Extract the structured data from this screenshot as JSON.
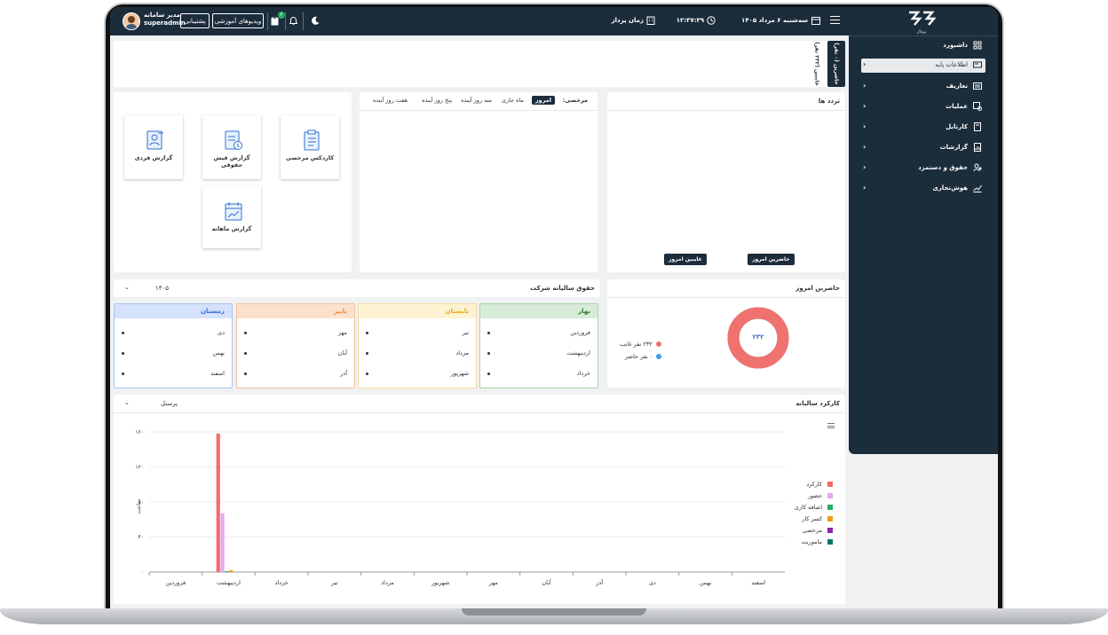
{
  "header": {
    "user_role": "مدیر سامانه",
    "username": "superadmin",
    "support_label": "پشتیبانی",
    "videos_label": "ویدیوهای آموزشی",
    "notif_count": "۴",
    "date": "سه‌شنبه ۶ مرداد ۱۴۰۵",
    "time": "۱۲:۳۷:۳۹",
    "timezone_label": "زمان پرداز"
  },
  "sidebar": {
    "logo_text": "پرداز",
    "items": [
      {
        "label": "داشبورد"
      },
      {
        "label": "اطلاعات پایه"
      },
      {
        "label": "تعاریف"
      },
      {
        "label": "عملیات"
      },
      {
        "label": "کارتابل"
      },
      {
        "label": "گزارشات"
      },
      {
        "label": "حقوق و دستمزد"
      },
      {
        "label": "هوش‌تجاری"
      }
    ]
  },
  "present_strip": {
    "tab_present": "حاضرین (۰ نفر)",
    "tab_absent": "غایبین (۲۳۲ نفر)"
  },
  "traffic": {
    "title": "تردد ها",
    "btn_present_today": "حاضرین امروز",
    "btn_absent_today": "غایبین امروز"
  },
  "leave": {
    "label": "مرخصی:",
    "tabs": [
      "امروز",
      "ماه جاری",
      "سه روز آینده",
      "پنج روز آینده",
      "هفت روز آینده"
    ]
  },
  "reports": {
    "cards": [
      {
        "label": "کاردکس مرخصی"
      },
      {
        "label": "گزارش فیش حقوقی"
      },
      {
        "label": "گزارش فردی"
      },
      {
        "label": "گزارش ماهانه"
      }
    ]
  },
  "present_today": {
    "title": "حاضرین امروز",
    "donut_value": "۲۳۲",
    "legend_absent": "۲۳۲ نفر غایب",
    "legend_present": "۰ نفر حاضر",
    "absent_fraction": 1.0,
    "absent_color": "#f0726f",
    "present_color": "#3b9ee5"
  },
  "salary": {
    "title": "حقوق سالیانه شرکت",
    "year": "۱۴۰۵",
    "seasons": [
      {
        "name": "بهار",
        "months": [
          "فروردین",
          "اردیبهشت",
          "خرداد"
        ],
        "color": "#2e7d32",
        "bg": "#d8ebd9",
        "border": "#a9d4ab"
      },
      {
        "name": "تابستان",
        "months": [
          "تیر",
          "مرداد",
          "شهریور"
        ],
        "color": "#e6a817",
        "bg": "#fdf3d3",
        "border": "#f3dd9a"
      },
      {
        "name": "پاییز",
        "months": [
          "مهر",
          "آبان",
          "آذر"
        ],
        "color": "#e8873a",
        "bg": "#fde1cf",
        "border": "#f3bf9c"
      },
      {
        "name": "زمستان",
        "months": [
          "دی",
          "بهمن",
          "اسفند"
        ],
        "color": "#3b6fd1",
        "bg": "#d4e2fb",
        "border": "#a8c3f0"
      }
    ]
  },
  "annual": {
    "title": "کارکرد سالیانه",
    "filter": "پرسنل"
  },
  "chart_data": {
    "type": "bar",
    "categories": [
      "فروردین",
      "اردیبهشت",
      "خرداد",
      "تیر",
      "مرداد",
      "شهریور",
      "مهر",
      "آبان",
      "آذر",
      "دی",
      "بهمن",
      "اسفند"
    ],
    "series": [
      {
        "name": "کارکرد",
        "color": "#f26b6b",
        "values": [
          0,
          158,
          0,
          0,
          0,
          0,
          0,
          0,
          0,
          0,
          0,
          0
        ]
      },
      {
        "name": "حضور",
        "color": "#e3a7f0",
        "values": [
          0,
          67,
          0,
          0,
          0,
          0,
          0,
          0,
          0,
          0,
          0,
          0
        ]
      },
      {
        "name": "اضافه کاری",
        "color": "#27ae60",
        "values": [
          0,
          1,
          0,
          0,
          0,
          0,
          0,
          0,
          0,
          0,
          0,
          0
        ]
      },
      {
        "name": "کسر کار",
        "color": "#f39c12",
        "values": [
          0,
          2,
          0,
          0,
          0,
          0,
          0,
          0,
          0,
          0,
          0,
          0
        ]
      },
      {
        "name": "مرخصی",
        "color": "#8e24aa",
        "values": [
          0,
          0,
          0,
          0,
          0,
          0,
          0,
          0,
          0,
          0,
          0,
          0
        ]
      },
      {
        "name": "ماموریت",
        "color": "#00796b",
        "values": [
          0,
          0,
          0,
          0,
          0,
          0,
          0,
          0,
          0,
          0,
          0,
          0
        ]
      }
    ],
    "yticks": [
      "۰",
      "۴۰",
      "۸۰",
      "۱۲۰",
      "۱۶۰"
    ],
    "ylim": [
      0,
      160
    ],
    "ylabel": "ساعت",
    "legend": "right",
    "grid": true
  }
}
